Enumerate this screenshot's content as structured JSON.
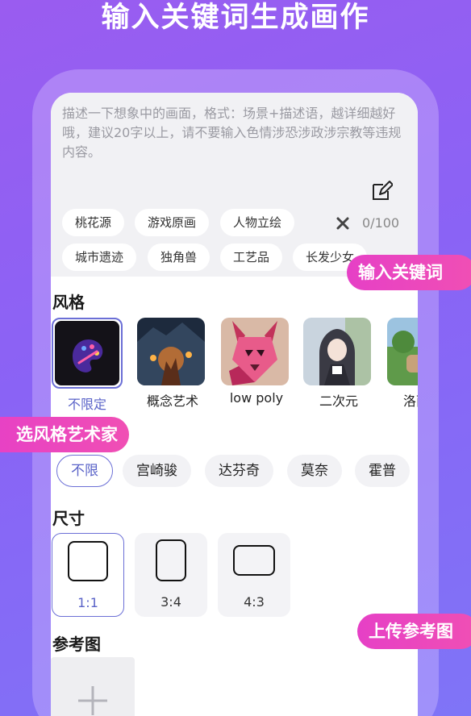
{
  "headline": "输入关键词生成画作",
  "prompt": {
    "placeholder": "描述一下想象中的画面，格式：场景+描述语，越详细越好哦，建议20字以上，请不要输入色情涉恐涉政涉宗教等违规内容。",
    "counter": "0/100",
    "chips_row1": [
      "桃花源",
      "游戏原画",
      "人物立绘"
    ],
    "chips_row2": [
      "城市遗迹",
      "独角兽",
      "工艺品",
      "长发少女"
    ]
  },
  "style": {
    "title": "风格",
    "items": [
      {
        "label": "不限定",
        "selected": true
      },
      {
        "label": "概念艺术"
      },
      {
        "label": "low poly"
      },
      {
        "label": "二次元"
      },
      {
        "label": "洛丽塔"
      }
    ]
  },
  "artists": [
    "不限",
    "宫崎骏",
    "达芬奇",
    "莫奈",
    "霍普"
  ],
  "size": {
    "title": "尺寸",
    "options": [
      {
        "label": "1:1",
        "selected": true
      },
      {
        "label": "3:4"
      },
      {
        "label": "4:3"
      }
    ]
  },
  "reference": {
    "title": "参考图"
  },
  "callouts": {
    "keywords": "输入关键词",
    "style_artist": "选风格艺术家",
    "upload": "上传参考图"
  },
  "colors": {
    "accent": "#6b6fd6",
    "pill": "#ec46bd",
    "bg": "#8a63f5"
  }
}
